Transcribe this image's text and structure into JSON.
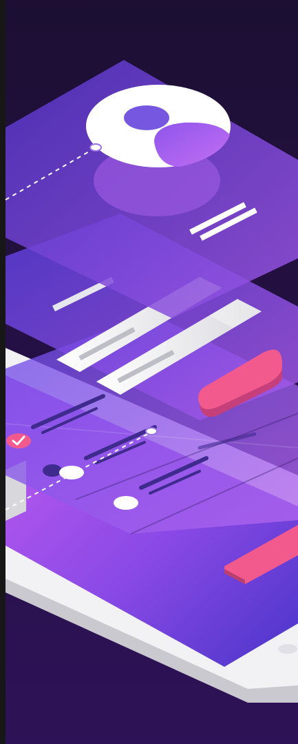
{
  "colors": {
    "background_top": "#1c0f33",
    "background_bottom": "#2e1257",
    "left_edge": "#171717",
    "panel_violet": "#7c4fe0",
    "panel_indigo": "#5b3fd9",
    "panel_magenta": "#b052e6",
    "accent_pink": "#f25a8e",
    "tablet_frame": "#f2f2f4",
    "tablet_edge": "#c9c9cf",
    "white": "#ffffff"
  },
  "icons": {
    "avatar": "user-avatar-icon",
    "checkbox": "checkmark-icon",
    "radio": "radio-toggle-icon",
    "home_button": "home-button-icon"
  },
  "checkbox_checked": true
}
